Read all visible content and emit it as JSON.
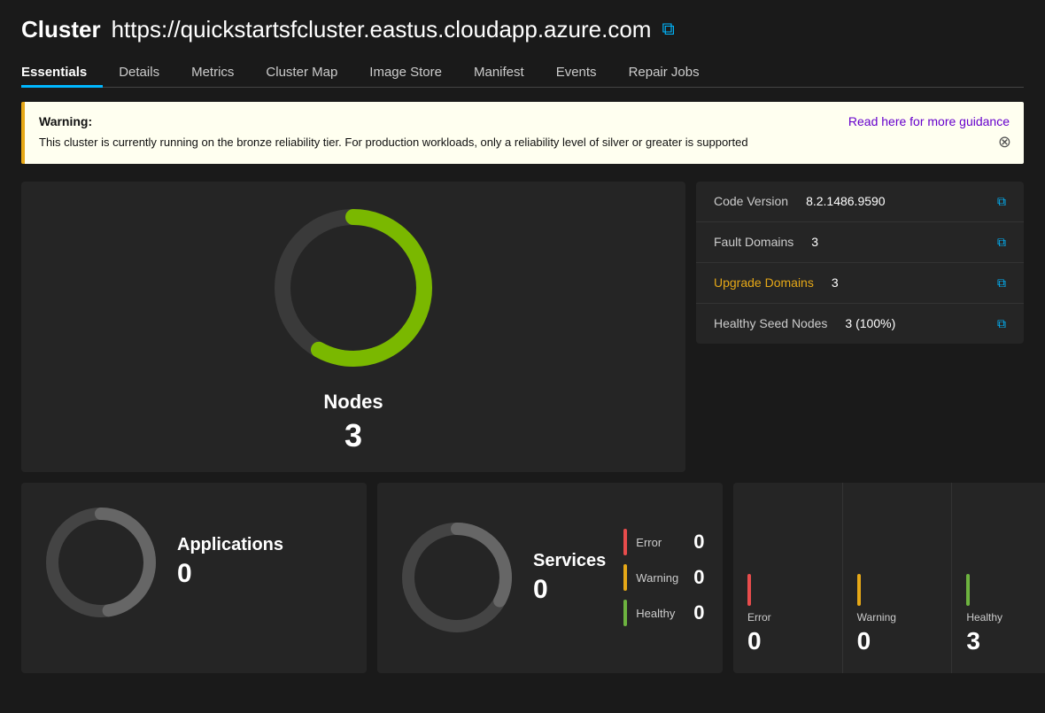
{
  "header": {
    "cluster_label": "Cluster",
    "cluster_url": "https://quickstartsfcluster.eastus.cloudapp.azure.com",
    "copy_icon": "⧉"
  },
  "nav": {
    "tabs": [
      {
        "id": "essentials",
        "label": "Essentials",
        "active": true
      },
      {
        "id": "details",
        "label": "Details",
        "active": false
      },
      {
        "id": "metrics",
        "label": "Metrics",
        "active": false
      },
      {
        "id": "cluster-map",
        "label": "Cluster Map",
        "active": false
      },
      {
        "id": "image-store",
        "label": "Image Store",
        "active": false
      },
      {
        "id": "manifest",
        "label": "Manifest",
        "active": false
      },
      {
        "id": "events",
        "label": "Events",
        "active": false
      },
      {
        "id": "repair-jobs",
        "label": "Repair Jobs",
        "active": false
      }
    ]
  },
  "warning": {
    "title": "Warning:",
    "link_text": "Read here for more guidance",
    "message": "This cluster is currently running on the bronze reliability tier. For production workloads, only a reliability level of silver or greater is supported",
    "close_icon": "⊗"
  },
  "info": {
    "rows": [
      {
        "label": "Code Version",
        "label_type": "normal",
        "value": "8.2.1486.9590"
      },
      {
        "label": "Fault Domains",
        "label_type": "normal",
        "value": "3"
      },
      {
        "label": "Upgrade Domains",
        "label_type": "warning",
        "value": "3"
      },
      {
        "label": "Healthy Seed Nodes",
        "label_type": "normal",
        "value": "3 (100%)"
      }
    ],
    "copy_icon": "⧉"
  },
  "nodes_panel": {
    "label": "Nodes",
    "count": "3",
    "donut_color": "#7ab800",
    "donut_bg": "#3a3a3a"
  },
  "applications": {
    "label": "Applications",
    "count": "0",
    "donut_color": "#888",
    "donut_bg": "#3a3a3a"
  },
  "services": {
    "label": "Services",
    "count": "0",
    "donut_color": "#888",
    "donut_bg": "#3a3a3a",
    "stats": [
      {
        "label": "Error",
        "value": "0",
        "type": "error"
      },
      {
        "label": "Warning",
        "value": "0",
        "type": "warning"
      },
      {
        "label": "Healthy",
        "value": "0",
        "type": "healthy"
      }
    ]
  },
  "nodes_stats": [
    {
      "label": "Error",
      "value": "0",
      "type": "error"
    },
    {
      "label": "Warning",
      "value": "0",
      "type": "warning"
    },
    {
      "label": "Healthy",
      "value": "3",
      "type": "healthy"
    }
  ]
}
